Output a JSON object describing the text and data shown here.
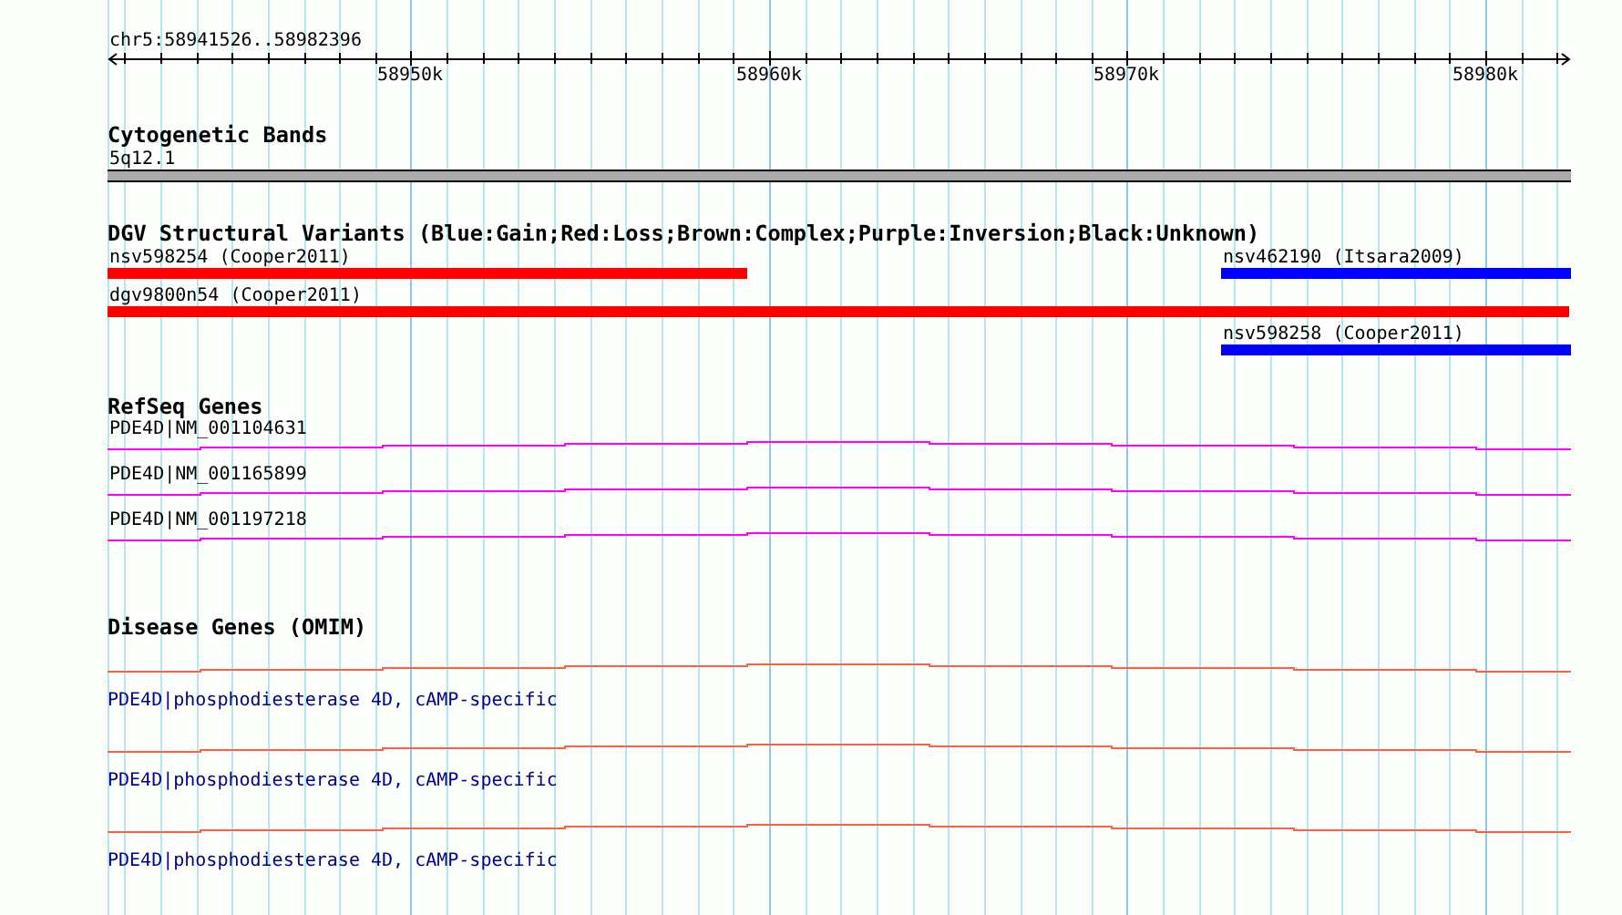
{
  "ruler": {
    "range": "chr5:58941526..58982396",
    "ticks": [
      "58950k",
      "58960k",
      "58970k",
      "58980k"
    ]
  },
  "tracks": [
    {
      "kind": "bands",
      "title": "Cytogenetic Bands",
      "features": [
        {
          "label": "5q12.1"
        }
      ]
    },
    {
      "kind": "variants",
      "title": "DGV Structural Variants (Blue:Gain;Red:Loss;Brown:Complex;Purple:Inversion;Black:Unknown)",
      "features": [
        {
          "label": "nsv598254 (Cooper2011)",
          "color": "#ff0000"
        },
        {
          "label": "nsv462190 (Itsara2009)",
          "color": "#0000ff"
        },
        {
          "label": "dgv9800n54 (Cooper2011)",
          "color": "#ff0000"
        },
        {
          "label": "nsv598258 (Cooper2011)",
          "color": "#0000ff"
        }
      ]
    },
    {
      "kind": "genes",
      "title": "RefSeq Genes",
      "features": [
        {
          "label": "PDE4D|NM_001104631"
        },
        {
          "label": "PDE4D|NM_001165899"
        },
        {
          "label": "PDE4D|NM_001197218"
        }
      ]
    },
    {
      "kind": "disease",
      "title": "Disease Genes (OMIM)",
      "features": [
        {
          "label": "PDE4D|phosphodiesterase 4D, cAMP-specific"
        },
        {
          "label": "PDE4D|phosphodiesterase 4D, cAMP-specific"
        },
        {
          "label": "PDE4D|phosphodiesterase 4D, cAMP-specific"
        }
      ]
    }
  ]
}
